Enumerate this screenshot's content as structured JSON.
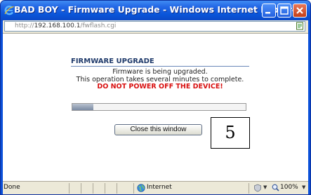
{
  "window": {
    "title": "BAD BOY - Firmware Upgrade - Windows Internet Explorer"
  },
  "addressbar": {
    "protocol": "http://",
    "host": "192.168.100.1",
    "path": "/fwflash.cgi"
  },
  "content": {
    "heading": "FIRMWARE UPGRADE",
    "message_line1": "Firmware is being upgraded.",
    "message_line2": "This operation takes several minutes to complete.",
    "warning": "DO NOT POWER OFF THE DEVICE!",
    "progress_percent": 12,
    "close_button_label": "Close this window"
  },
  "annotation": {
    "label": "5"
  },
  "statusbar": {
    "status": "Done",
    "zone": "Internet",
    "zoom": "100%"
  },
  "icons": {
    "browser": "internet-explorer-icon",
    "page": "page-icon",
    "zone": "globe-icon",
    "protected_mode": "shield-icon",
    "zoom": "magnifier-icon"
  },
  "colors": {
    "titlebar": "#0a55d9",
    "heading": "#1f3a6b",
    "warning": "#d81010",
    "progress_fill": "#7a8aa3"
  }
}
